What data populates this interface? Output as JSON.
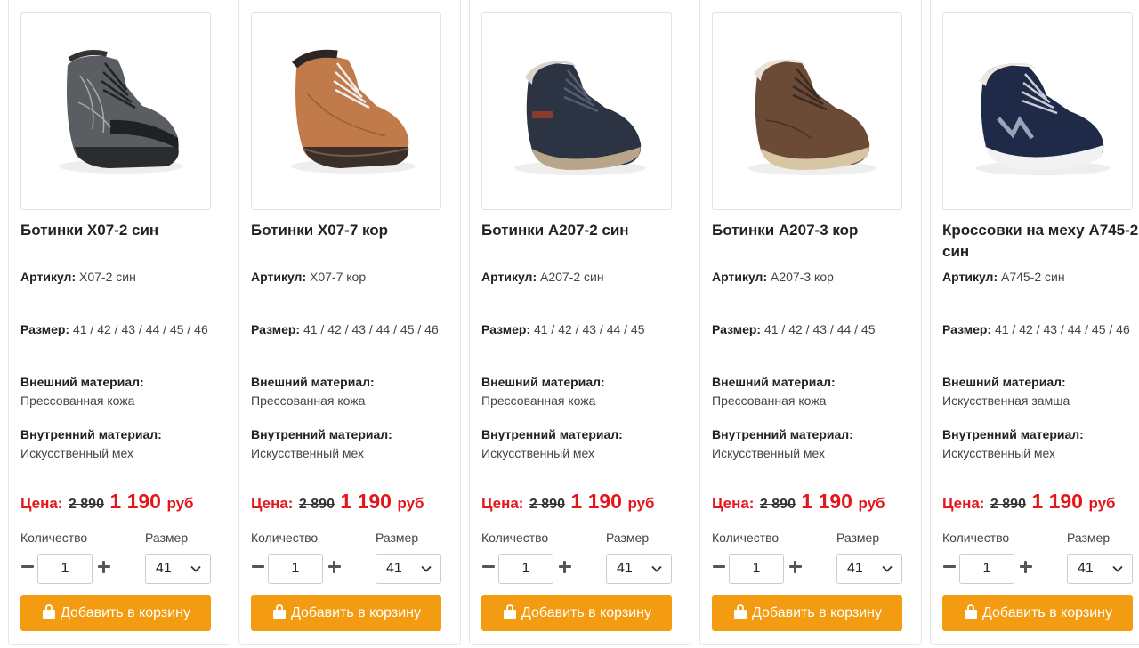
{
  "labels": {
    "article": "Артикул:",
    "size": "Размер:",
    "outer": "Внешний материал:",
    "inner": "Внутренний материал:",
    "price": "Цена:",
    "currency": "руб",
    "quantity": "Количество",
    "size_select": "Размер",
    "add_to_cart": "Добавить в корзину"
  },
  "colors": {
    "accent": "#f39c12",
    "price_red": "#e4161c"
  },
  "products": [
    {
      "title": "Ботинки X07-2 син",
      "article": "X07-2 син",
      "sizes": "41 / 42 / 43 / 44 / 45 / 46",
      "outer": "Прессованная кожа",
      "inner": "Искусственный мех",
      "old_price": "2 890",
      "new_price": "1 190",
      "qty": "1",
      "size_selected": "41",
      "image": "dark-grey-hiking-boot"
    },
    {
      "title": "Ботинки X07-7 кор",
      "article": "X07-7 кор",
      "sizes": "41 / 42 / 43 / 44 / 45 / 46",
      "outer": "Прессованная кожа",
      "inner": "Искусственный мех",
      "old_price": "2 890",
      "new_price": "1 190",
      "qty": "1",
      "size_selected": "41",
      "image": "tan-brown-hiking-boot"
    },
    {
      "title": "Ботинки A207-2 син",
      "article": "A207-2 син",
      "sizes": "41 / 42 / 43 / 44 / 45",
      "outer": "Прессованная кожа",
      "inner": "Искусственный мех",
      "old_price": "2 890",
      "new_price": "1 190",
      "qty": "1",
      "size_selected": "41",
      "image": "navy-fur-boot"
    },
    {
      "title": "Ботинки A207-3 кор",
      "article": "A207-3 кор",
      "sizes": "41 / 42 / 43 / 44 / 45",
      "outer": "Прессованная кожа",
      "inner": "Искусственный мех",
      "old_price": "2 890",
      "new_price": "1 190",
      "qty": "1",
      "size_selected": "41",
      "image": "brown-fur-boot"
    },
    {
      "title": "Кроссовки на меху A745-2 син",
      "article": "A745-2 син",
      "sizes": "41 / 42 / 43 / 44 / 45 / 46",
      "outer": "Искусственная замша",
      "inner": "Искусственный мех",
      "old_price": "2 890",
      "new_price": "1 190",
      "qty": "1",
      "size_selected": "41",
      "image": "navy-fur-sneaker"
    }
  ]
}
